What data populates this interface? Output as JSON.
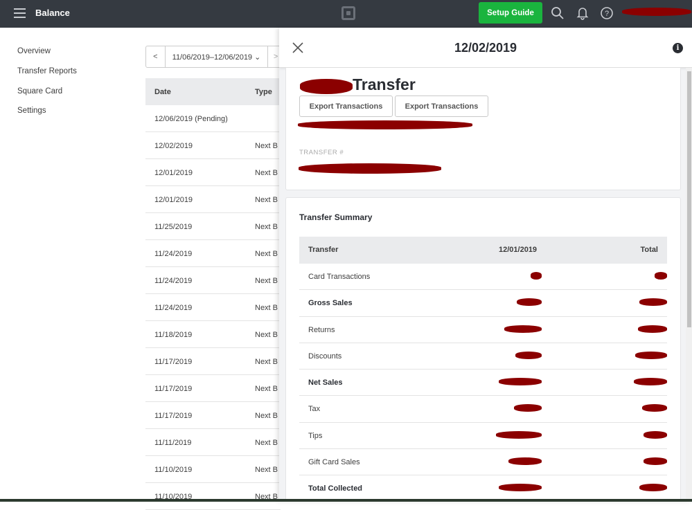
{
  "topbar": {
    "title": "Balance",
    "setup_guide_label": "Setup Guide",
    "icons": [
      "menu-icon",
      "square-logo-icon",
      "search-icon",
      "bell-icon",
      "help-icon"
    ],
    "account_name": "[redacted]"
  },
  "sidebar": {
    "items": [
      {
        "label": "Overview"
      },
      {
        "label": "Transfer Reports"
      },
      {
        "label": "Square Card"
      },
      {
        "label": "Settings"
      }
    ]
  },
  "filter": {
    "prev": "<",
    "range": "11/06/2019–12/06/2019 ⌄",
    "next": ">"
  },
  "transfers_list": {
    "columns": [
      "Date",
      "Type"
    ],
    "rows": [
      {
        "date": "12/06/2019 (Pending)",
        "type": ""
      },
      {
        "date": "12/02/2019",
        "type": "Next B"
      },
      {
        "date": "12/01/2019",
        "type": "Next B"
      },
      {
        "date": "12/01/2019",
        "type": "Next B"
      },
      {
        "date": "11/25/2019",
        "type": "Next B"
      },
      {
        "date": "11/24/2019",
        "type": "Next B"
      },
      {
        "date": "11/24/2019",
        "type": "Next B"
      },
      {
        "date": "11/24/2019",
        "type": "Next B"
      },
      {
        "date": "11/18/2019",
        "type": "Next B"
      },
      {
        "date": "11/17/2019",
        "type": "Next B"
      },
      {
        "date": "11/17/2019",
        "type": "Next B"
      },
      {
        "date": "11/17/2019",
        "type": "Next B"
      },
      {
        "date": "11/11/2019",
        "type": "Next B"
      },
      {
        "date": "11/10/2019",
        "type": "Next B"
      },
      {
        "date": "11/10/2019",
        "type": "Next B"
      }
    ]
  },
  "detail_panel": {
    "title": "12/02/2019",
    "info_glyph": "i",
    "transfer_heading": "Transfer",
    "export_buttons": [
      "Export Transactions",
      "Export Transactions"
    ],
    "transfer_number_label": "TRANSFER #",
    "summary": {
      "title": "Transfer Summary",
      "columns": [
        "Transfer",
        "12/01/2019",
        "Total"
      ],
      "rows": [
        {
          "label": "Card Transactions",
          "bold": false
        },
        {
          "label": "Gross Sales",
          "bold": true
        },
        {
          "label": "Returns",
          "bold": false
        },
        {
          "label": "Discounts",
          "bold": false
        },
        {
          "label": "Net Sales",
          "bold": true
        },
        {
          "label": "Tax",
          "bold": false
        },
        {
          "label": "Tips",
          "bold": false
        },
        {
          "label": "Gift Card Sales",
          "bold": false
        },
        {
          "label": "Total Collected",
          "bold": true
        }
      ]
    }
  },
  "colors": {
    "topbar_bg": "#353a41",
    "setup_green": "#1ab43e",
    "redaction": "#8b0000"
  }
}
